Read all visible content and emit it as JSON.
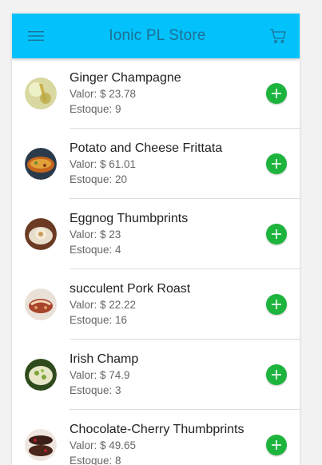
{
  "colors": {
    "toolbar_bg": "#03c2fb",
    "toolbar_fg": "#1d6f94",
    "add_button": "#1db43d"
  },
  "header": {
    "title": "Ionic PL Store",
    "menu_icon": "menu-icon",
    "cart_icon": "cart-icon"
  },
  "labels": {
    "price_prefix": "Valor: $ ",
    "stock_prefix": "Estoque: "
  },
  "products": [
    {
      "name": "Ginger Champagne",
      "price": "Valor: $ 23.78",
      "stock": "Estoque: 9"
    },
    {
      "name": "Potato and Cheese Frittata",
      "price": "Valor: $ 61.01",
      "stock": "Estoque: 20"
    },
    {
      "name": "Eggnog Thumbprints",
      "price": "Valor: $ 23",
      "stock": "Estoque: 4"
    },
    {
      "name": "succulent Pork Roast",
      "price": "Valor: $ 22.22",
      "stock": "Estoque: 16"
    },
    {
      "name": "Irish Champ",
      "price": "Valor: $ 74.9",
      "stock": "Estoque: 3"
    },
    {
      "name": "Chocolate-Cherry Thumbprints",
      "price": "Valor: $ 49.65",
      "stock": "Estoque: 8"
    }
  ]
}
